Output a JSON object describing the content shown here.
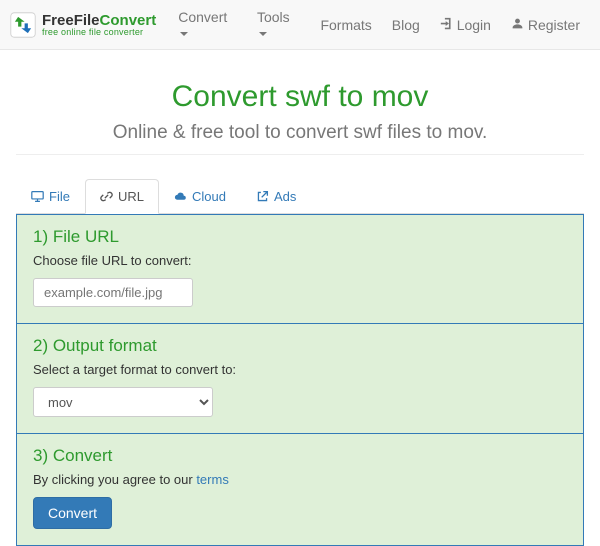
{
  "brand": {
    "title_free": "Free",
    "title_file": "File",
    "title_convert": "Convert",
    "tagline": "free online file converter"
  },
  "nav": {
    "convert": "Convert",
    "tools": "Tools",
    "formats": "Formats",
    "blog": "Blog",
    "login": "Login",
    "register": "Register"
  },
  "page": {
    "title": "Convert swf to mov",
    "subtitle": "Online & free tool to convert swf files to mov."
  },
  "tabs": {
    "file": "File",
    "url": "URL",
    "cloud": "Cloud",
    "ads": "Ads"
  },
  "step1": {
    "heading": "1) File URL",
    "desc": "Choose file URL to convert:",
    "placeholder": "example.com/file.jpg"
  },
  "step2": {
    "heading": "2) Output format",
    "desc": "Select a target format to convert to:",
    "value": "mov"
  },
  "step3": {
    "heading": "3) Convert",
    "terms_prefix": "By clicking you agree to our ",
    "terms_link": "terms",
    "button": "Convert"
  }
}
